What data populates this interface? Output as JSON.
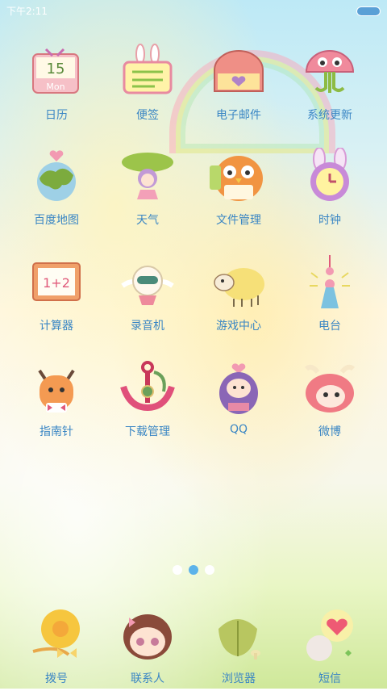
{
  "status_bar": {
    "time": "下午2:11",
    "battery_icon": "battery-icon"
  },
  "apps": [
    {
      "label": "日历",
      "icon": "calendar-icon",
      "text": "15",
      "subtext": "Mon"
    },
    {
      "label": "便签",
      "icon": "notes-icon"
    },
    {
      "label": "电子邮件",
      "icon": "mailbox-icon"
    },
    {
      "label": "系统更新",
      "icon": "mushroom-icon"
    },
    {
      "label": "百度地图",
      "icon": "globe-icon"
    },
    {
      "label": "天气",
      "icon": "leaf-girl-icon"
    },
    {
      "label": "文件管理",
      "icon": "owl-icon"
    },
    {
      "label": "时钟",
      "icon": "bunny-clock-icon"
    },
    {
      "label": "计算器",
      "icon": "calculator-icon",
      "text": "1+2"
    },
    {
      "label": "录音机",
      "icon": "bird-icon"
    },
    {
      "label": "游戏中心",
      "icon": "sheep-icon"
    },
    {
      "label": "电台",
      "icon": "tower-icon"
    },
    {
      "label": "指南针",
      "icon": "cat-icon"
    },
    {
      "label": "下载管理",
      "icon": "anchor-icon"
    },
    {
      "label": "QQ",
      "icon": "penguin-icon"
    },
    {
      "label": "微博",
      "icon": "pink-creature-icon"
    }
  ],
  "pager": {
    "count": 3,
    "active": 2
  },
  "dock": [
    {
      "label": "拨号",
      "icon": "flower-phone-icon"
    },
    {
      "label": "联系人",
      "icon": "doll-icon"
    },
    {
      "label": "浏览器",
      "icon": "leaf-browser-icon"
    },
    {
      "label": "短信",
      "icon": "heart-balloon-icon"
    }
  ]
}
